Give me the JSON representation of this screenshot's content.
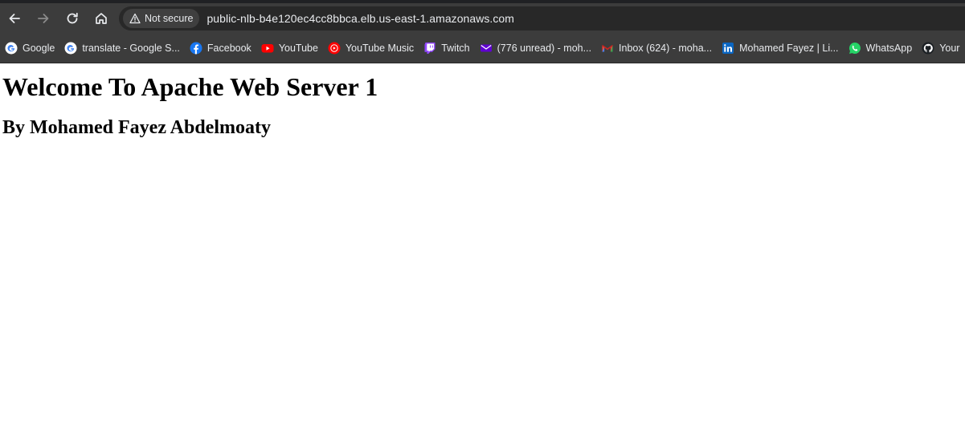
{
  "browser": {
    "security_label": "Not secure",
    "url": "public-nlb-b4e120ec4cc8bbca.elb.us-east-1.amazonaws.com",
    "nav": {
      "back_icon": "arrow-left-icon",
      "forward_icon": "arrow-right-icon",
      "reload_icon": "reload-icon",
      "home_icon": "home-icon"
    },
    "bookmarks": [
      {
        "label": "Google",
        "icon": "google-icon"
      },
      {
        "label": "translate - Google S...",
        "icon": "google-icon"
      },
      {
        "label": "Facebook",
        "icon": "facebook-icon"
      },
      {
        "label": "YouTube",
        "icon": "youtube-icon"
      },
      {
        "label": "YouTube Music",
        "icon": "youtube-music-icon"
      },
      {
        "label": "Twitch",
        "icon": "twitch-icon"
      },
      {
        "label": "(776 unread) - moh...",
        "icon": "yahoo-mail-icon"
      },
      {
        "label": "Inbox (624) - moha...",
        "icon": "gmail-icon"
      },
      {
        "label": "Mohamed Fayez | Li...",
        "icon": "linkedin-icon"
      },
      {
        "label": "WhatsApp",
        "icon": "whatsapp-icon"
      },
      {
        "label": "Your",
        "icon": "github-icon"
      }
    ]
  },
  "page": {
    "heading": "Welcome To Apache Web Server 1",
    "subheading": "By Mohamed Fayez Abdelmoaty"
  },
  "colors": {
    "chrome_bg": "#3c3c3c",
    "address_bg": "#282828",
    "chrome_text": "#e8eaed",
    "page_bg": "#ffffff"
  }
}
